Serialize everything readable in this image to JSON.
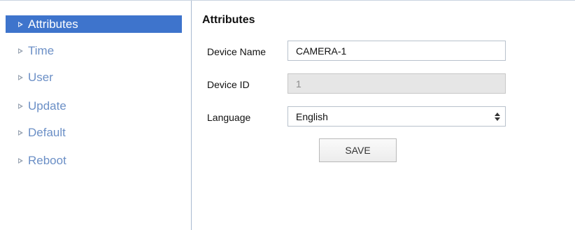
{
  "sidebar": {
    "items": [
      {
        "label": "Attributes",
        "active": true
      },
      {
        "label": "Time",
        "active": false
      },
      {
        "label": "User",
        "active": false
      },
      {
        "label": "Update",
        "active": false
      },
      {
        "label": "Default",
        "active": false
      },
      {
        "label": "Reboot",
        "active": false
      }
    ],
    "arrow_icon": "triangle-right-icon"
  },
  "main": {
    "title": "Attributes",
    "fields": {
      "device_name": {
        "label": "Device Name",
        "value": "CAMERA-1"
      },
      "device_id": {
        "label": "Device ID",
        "value": "1",
        "disabled": true
      },
      "language": {
        "label": "Language",
        "value": "English",
        "icon": "updown-arrows-icon"
      }
    },
    "save_label": "SAVE"
  },
  "colors": {
    "active_nav_bg": "#3e74cc",
    "nav_text": "#6b8fc6",
    "divider": "#a8b9d0"
  }
}
